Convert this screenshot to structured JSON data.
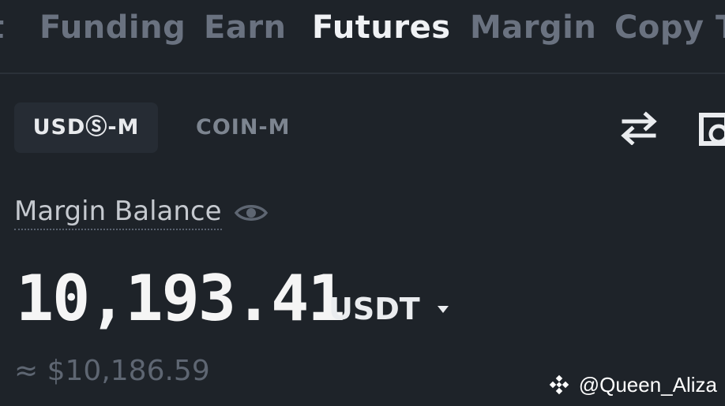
{
  "nav": {
    "tabs": [
      {
        "label": "t",
        "active": false
      },
      {
        "label": "Funding",
        "active": false
      },
      {
        "label": "Earn",
        "active": false
      },
      {
        "label": "Futures",
        "active": true
      },
      {
        "label": "Margin",
        "active": false
      },
      {
        "label": "Copy T",
        "active": false
      }
    ]
  },
  "mode": {
    "usds_m": "USDⓈ-M",
    "coin_m": "COIN-M",
    "selected": "USDⓈ-M"
  },
  "icons": {
    "transfer": "swap-arrows-icon",
    "partial": "partially-visible-icon",
    "eye": "eye-icon",
    "caret": "caret-down-icon",
    "watermark_logo": "binance-logo-icon"
  },
  "balance": {
    "label": "Margin Balance",
    "value": "10,193.41",
    "currency": "USDT",
    "approx": "≈ $10,186.59"
  },
  "watermark": {
    "text": "@Queen_Aliza"
  },
  "colors": {
    "background": "#1e2329",
    "active_text": "#f0f2f5",
    "inactive_text": "#6a7280",
    "approx_text": "#5e6672"
  }
}
